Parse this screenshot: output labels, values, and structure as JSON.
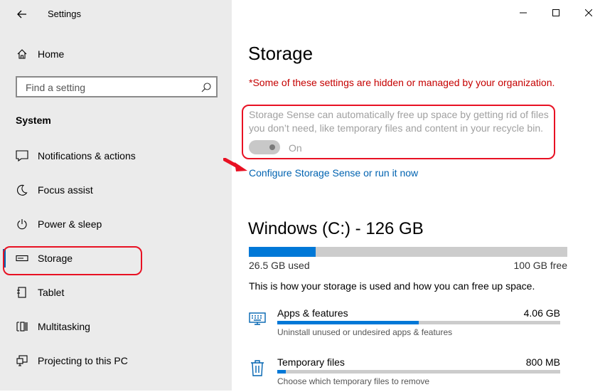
{
  "window": {
    "title": "Settings",
    "controls": [
      "minimize",
      "maximize",
      "close"
    ]
  },
  "sidebar": {
    "home_label": "Home",
    "search_placeholder": "Find a setting",
    "section_title": "System",
    "items": [
      {
        "label": "Notifications & actions",
        "icon": "notifications-icon"
      },
      {
        "label": "Focus assist",
        "icon": "moon-icon"
      },
      {
        "label": "Power & sleep",
        "icon": "power-icon"
      },
      {
        "label": "Storage",
        "icon": "storage-drive-icon",
        "selected": true
      },
      {
        "label": "Tablet",
        "icon": "tablet-icon"
      },
      {
        "label": "Multitasking",
        "icon": "multitasking-icon"
      },
      {
        "label": "Projecting to this PC",
        "icon": "projecting-icon"
      }
    ]
  },
  "main": {
    "title": "Storage",
    "org_warning": "*Some of these settings are hidden or managed by your organization.",
    "sense_description": "Storage Sense can automatically free up space by getting rid of files you don’t need, like temporary files and content in your recycle bin.",
    "toggle_state": "On",
    "configure_link": "Configure Storage Sense or run it now",
    "drive": {
      "title": "Windows (C:) - 126 GB",
      "used_label": "26.5 GB used",
      "free_label": "100 GB free",
      "used_fraction": 0.21
    },
    "usage_description": "This is how your storage is used and how you can free up space.",
    "categories": [
      {
        "name": "Apps & features",
        "size": "4.06 GB",
        "description": "Uninstall unused or undesired apps & features",
        "fraction": 0.5,
        "icon": "apps-features-icon"
      },
      {
        "name": "Temporary files",
        "size": "800 MB",
        "description": "Choose which temporary files to remove",
        "fraction": 0.03,
        "icon": "trash-icon"
      }
    ]
  },
  "colors": {
    "accent": "#0078d7",
    "link": "#0063b1",
    "warning": "#c50000",
    "highlight": "#e81123",
    "sidebar_bg": "#ebebeb"
  }
}
